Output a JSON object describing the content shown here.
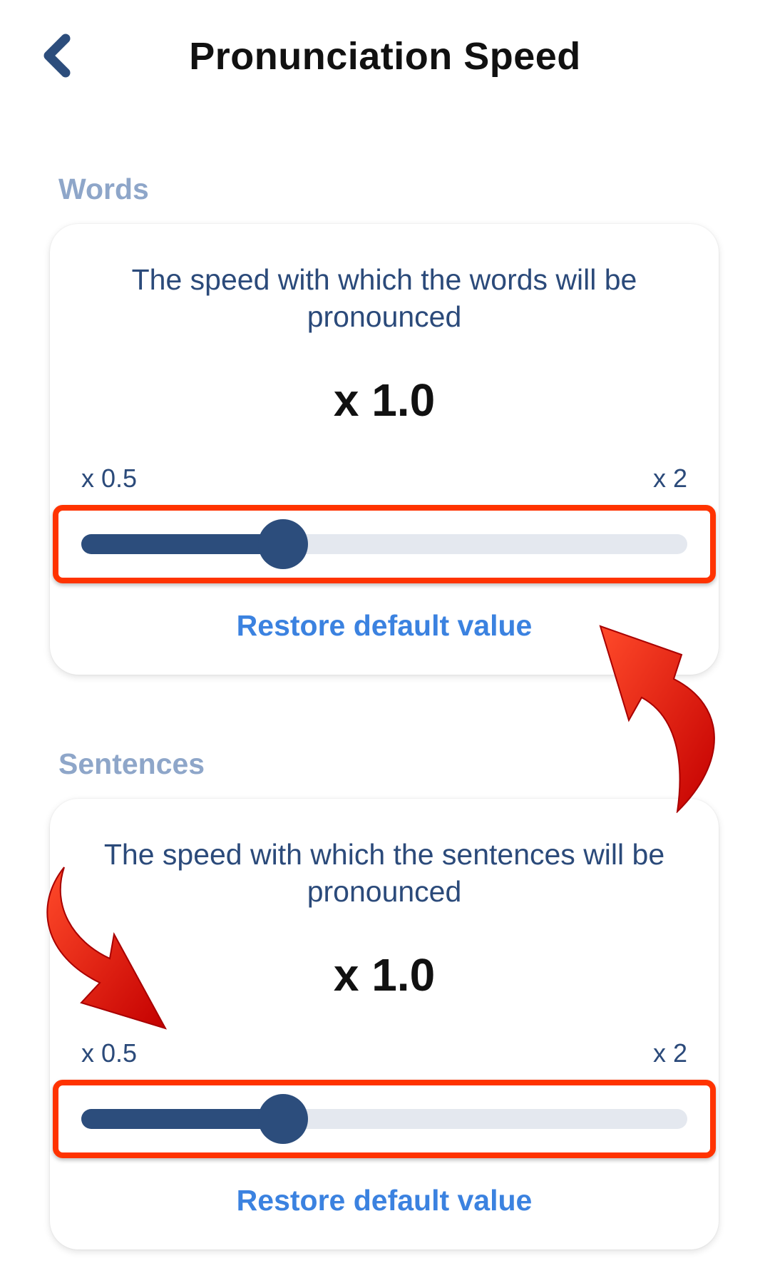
{
  "header": {
    "title": "Pronunciation Speed",
    "back_icon": "chevron-left-icon"
  },
  "colors": {
    "accent": "#2c4d7c",
    "link": "#3b82e0",
    "section_label": "#8ea6c9",
    "highlight": "#ff3300"
  },
  "sections": [
    {
      "label": "Words",
      "description": "The speed with which the words will be pronounced",
      "value": "x 1.0",
      "min_label": "x 0.5",
      "max_label": "x 2",
      "slider_fraction": 0.333,
      "restore_label": "Restore default value"
    },
    {
      "label": "Sentences",
      "description": "The speed with which the sentences will be pronounced",
      "value": "x 1.0",
      "min_label": "x 0.5",
      "max_label": "x 2",
      "slider_fraction": 0.333,
      "restore_label": "Restore default value"
    }
  ]
}
